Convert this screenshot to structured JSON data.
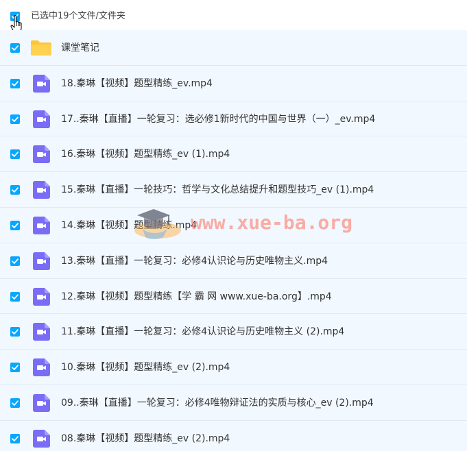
{
  "header": {
    "selection_text": "已选中19个文件/文件夹"
  },
  "items": [
    {
      "type": "folder",
      "icon": "folder-icon",
      "name": "课堂笔记"
    },
    {
      "type": "video",
      "icon": "video-file-icon",
      "name": "18.秦琳【视频】题型精练_ev.mp4"
    },
    {
      "type": "video",
      "icon": "video-file-icon",
      "name": "17..秦琳【直播】一轮复习：选必修1新时代的中国与世界（一）_ev.mp4"
    },
    {
      "type": "video",
      "icon": "video-file-icon",
      "name": "16.秦琳【视频】题型精练_ev (1).mp4"
    },
    {
      "type": "video",
      "icon": "video-file-icon",
      "name": "15.秦琳【直播】一轮技巧：哲学与文化总结提升和题型技巧_ev (1).mp4"
    },
    {
      "type": "video",
      "icon": "video-file-icon",
      "name": "14.秦琳【视频】题型精练.mp4"
    },
    {
      "type": "video",
      "icon": "video-file-icon",
      "name": "13.秦琳【直播】一轮复习：必修4认识论与历史唯物主义.mp4"
    },
    {
      "type": "video",
      "icon": "video-file-icon",
      "name": "12.秦琳【视频】题型精练【学 霸 网 www.xue-ba.org】.mp4"
    },
    {
      "type": "video",
      "icon": "video-file-icon",
      "name": "11.秦琳【直播】一轮复习：必修4认识论与历史唯物主义 (2).mp4"
    },
    {
      "type": "video",
      "icon": "video-file-icon",
      "name": "10.秦琳【视频】题型精练_ev (2).mp4"
    },
    {
      "type": "video",
      "icon": "video-file-icon",
      "name": "09..秦琳【直播】一轮复习：必修4唯物辩证法的实质与核心_ev (2).mp4"
    },
    {
      "type": "video",
      "icon": "video-file-icon",
      "name": "08.秦琳【视频】题型精练_ev (2).mp4"
    }
  ],
  "watermark": {
    "text": "www.xue-ba.org"
  },
  "colors": {
    "checkbox": "#06a7ff",
    "row_background": "#f2f8ff",
    "video_icon": "#7b6cf6",
    "folder": "#ffc533"
  }
}
